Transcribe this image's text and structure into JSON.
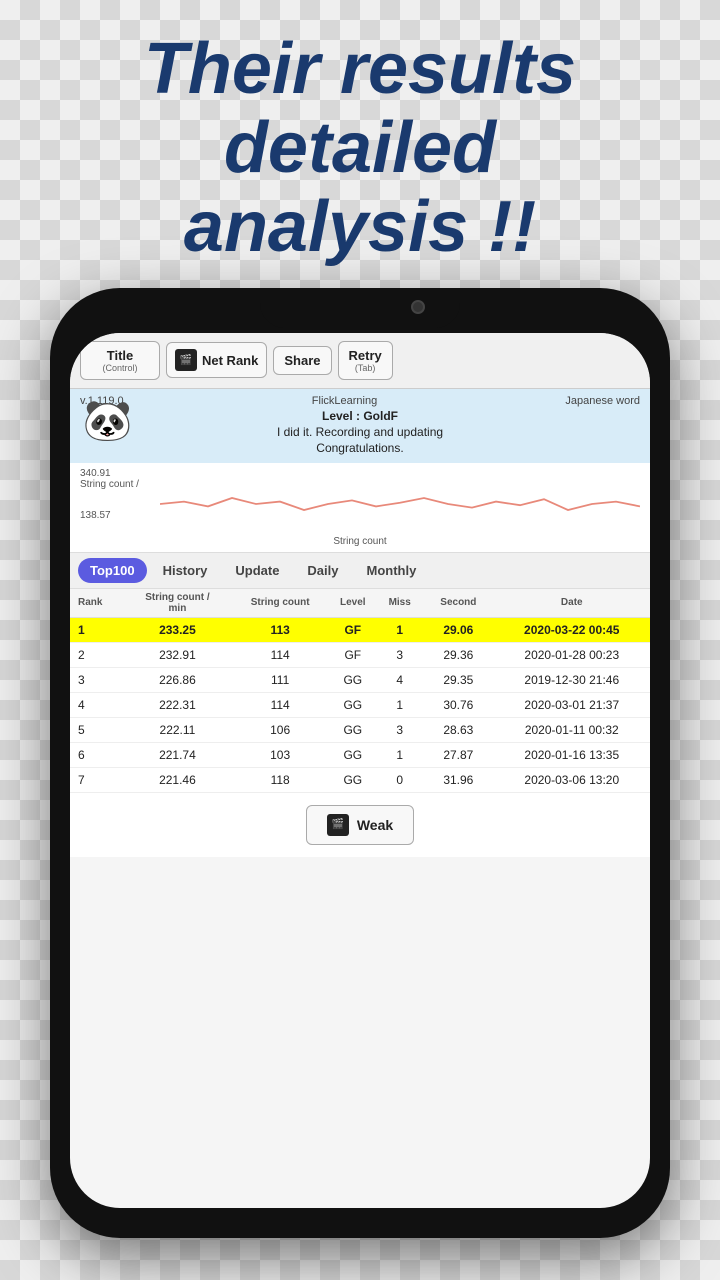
{
  "headline": {
    "line1": "Their results",
    "line2": "detailed",
    "line3": "analysis !!"
  },
  "toolbar": {
    "title_label": "Title",
    "title_sublabel": "(Control)",
    "net_rank_label": "Net Rank",
    "share_label": "Share",
    "retry_label": "Retry",
    "retry_sublabel": "(Tab)"
  },
  "info": {
    "version": "v.1.119.0",
    "app_name": "FlickLearning",
    "level": "Level : GoldF",
    "message": "I did it. Recording and updating",
    "message2": "Congratulations.",
    "type": "Japanese word"
  },
  "chart": {
    "y_max": "340.91",
    "y_label": "String count /",
    "y_min": "138.57",
    "x_label": "String count"
  },
  "tabs": [
    {
      "id": "top100",
      "label": "Top100",
      "active": true
    },
    {
      "id": "history",
      "label": "History",
      "active": false
    },
    {
      "id": "update",
      "label": "Update",
      "active": false
    },
    {
      "id": "daily",
      "label": "Daily",
      "active": false
    },
    {
      "id": "monthly",
      "label": "Monthly",
      "active": false
    }
  ],
  "table": {
    "headers": [
      "Rank",
      "String count /\nmin",
      "String count",
      "Level",
      "Miss",
      "Second",
      "Date"
    ],
    "rows": [
      {
        "rank": "1",
        "string_rate": "233.25",
        "string_count": "113",
        "level": "GF",
        "miss": "1",
        "second": "29.06",
        "date": "2020-03-22 00:45",
        "highlight": true
      },
      {
        "rank": "2",
        "string_rate": "232.91",
        "string_count": "114",
        "level": "GF",
        "miss": "3",
        "second": "29.36",
        "date": "2020-01-28 00:23",
        "highlight": false
      },
      {
        "rank": "3",
        "string_rate": "226.86",
        "string_count": "111",
        "level": "GG",
        "miss": "4",
        "second": "29.35",
        "date": "2019-12-30 21:46",
        "highlight": false
      },
      {
        "rank": "4",
        "string_rate": "222.31",
        "string_count": "114",
        "level": "GG",
        "miss": "1",
        "second": "30.76",
        "date": "2020-03-01 21:37",
        "highlight": false
      },
      {
        "rank": "5",
        "string_rate": "222.11",
        "string_count": "106",
        "level": "GG",
        "miss": "3",
        "second": "28.63",
        "date": "2020-01-11 00:32",
        "highlight": false
      },
      {
        "rank": "6",
        "string_rate": "221.74",
        "string_count": "103",
        "level": "GG",
        "miss": "1",
        "second": "27.87",
        "date": "2020-01-16 13:35",
        "highlight": false
      },
      {
        "rank": "7",
        "string_rate": "221.46",
        "string_count": "118",
        "level": "GG",
        "miss": "0",
        "second": "31.96",
        "date": "2020-03-06 13:20",
        "highlight": false
      }
    ]
  },
  "weak_button": {
    "label": "Weak"
  }
}
